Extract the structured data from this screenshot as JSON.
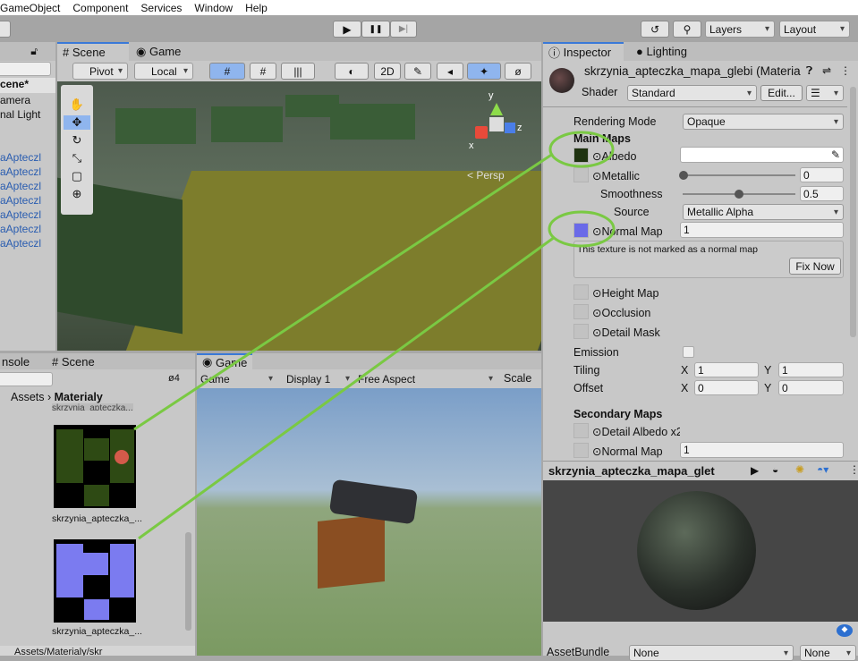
{
  "menu": [
    "GameObject",
    "Component",
    "Services",
    "Window",
    "Help"
  ],
  "toolbar": {
    "play": "▶",
    "pause": "❚❚",
    "step": "▶|",
    "layers": "Layers",
    "layout": "Layout"
  },
  "hierarchy": {
    "scene": "cene*",
    "items": [
      "amera",
      "nal Light"
    ],
    "prefabs": [
      "aApteczl",
      "aApteczl",
      "aApteczl",
      "aApteczl",
      "aApteczl",
      "aApteczl",
      "aApteczl"
    ]
  },
  "scene": {
    "tabs": [
      "Scene",
      "Game"
    ],
    "pivot": "Pivot",
    "local": "Local",
    "mode2d": "2D",
    "persp": "< Persp",
    "axes": {
      "y": "y",
      "x": "x",
      "z": "z"
    }
  },
  "project": {
    "tabs": [
      "nsole",
      "Scene"
    ],
    "hidden_count": "4",
    "breadcrumb": [
      "Assets",
      "Materialy"
    ],
    "top_item": "skrzynia_apteczka...",
    "items": [
      "skrzynia_apteczka_...",
      "skrzynia_apteczka_..."
    ],
    "path": "Assets/Materialy/skr"
  },
  "game": {
    "tab": "Game",
    "view": "Game",
    "display": "Display 1",
    "aspect": "Free Aspect",
    "scale": "Scale"
  },
  "inspector": {
    "tabs": [
      "Inspector",
      "Lighting"
    ],
    "title": "skrzynia_apteczka_mapa_glebi (Materia",
    "shader_label": "Shader",
    "shader": "Standard",
    "edit": "Edit...",
    "rendering_mode_label": "Rendering Mode",
    "rendering_mode": "Opaque",
    "main_maps": "Main Maps",
    "albedo": "Albedo",
    "metallic": "Metallic",
    "metallic_value": "0",
    "smoothness": "Smoothness",
    "smoothness_value": "0.5",
    "source_label": "Source",
    "source": "Metallic Alpha",
    "normal_map": "Normal Map",
    "normal_value": "1",
    "warning": "This texture is not marked as a normal map",
    "fix_now": "Fix Now",
    "height_map": "Height Map",
    "occlusion": "Occlusion",
    "detail_mask": "Detail Mask",
    "emission": "Emission",
    "tiling": "Tiling",
    "offset": "Offset",
    "x": "X",
    "y": "Y",
    "tiling_x": "1",
    "tiling_y": "1",
    "offset_x": "0",
    "offset_y": "0",
    "secondary_maps": "Secondary Maps",
    "detail_albedo": "Detail Albedo x2",
    "sec_normal": "Normal Map",
    "sec_normal_value": "1",
    "preview_title": "skrzynia_apteczka_mapa_glet",
    "asset_bundle": "AssetBundle",
    "bundle": "None",
    "variant": "None"
  },
  "colors": {
    "annotation": "#7ac943",
    "accent": "#3a79d8"
  }
}
